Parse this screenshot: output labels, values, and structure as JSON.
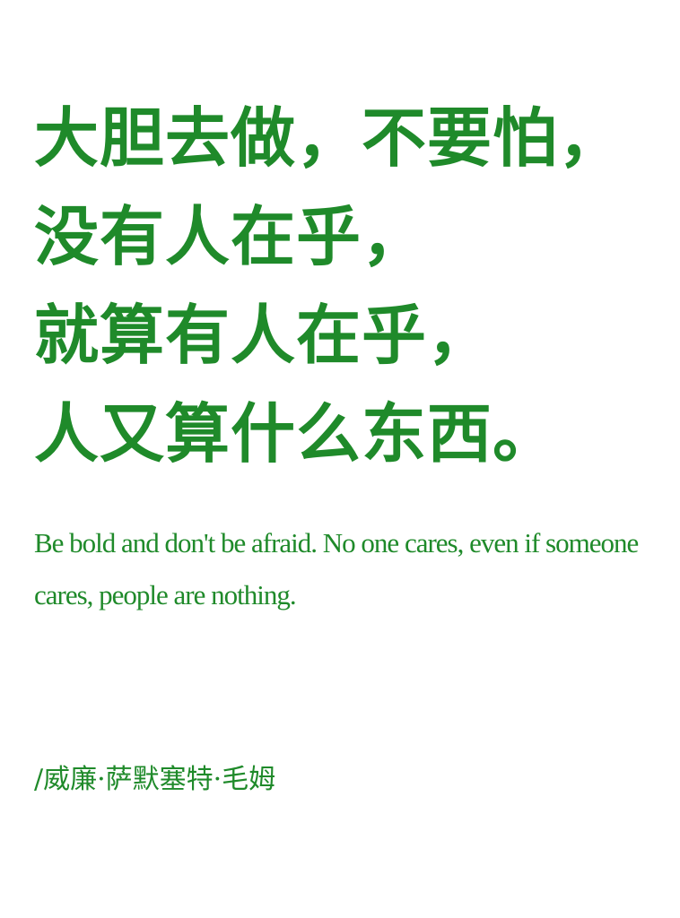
{
  "quote": {
    "chinese_lines": [
      "大胆去做，不要怕，",
      "没有人在乎，",
      "就算有人在乎，",
      "人又算什么东西。"
    ],
    "english": "Be bold and don't be afraid. No one cares, even if someone cares, people are nothing.",
    "author": "/威廉·萨默塞特·毛姆"
  },
  "colors": {
    "text": "#1f8a2a",
    "background": "#ffffff"
  }
}
